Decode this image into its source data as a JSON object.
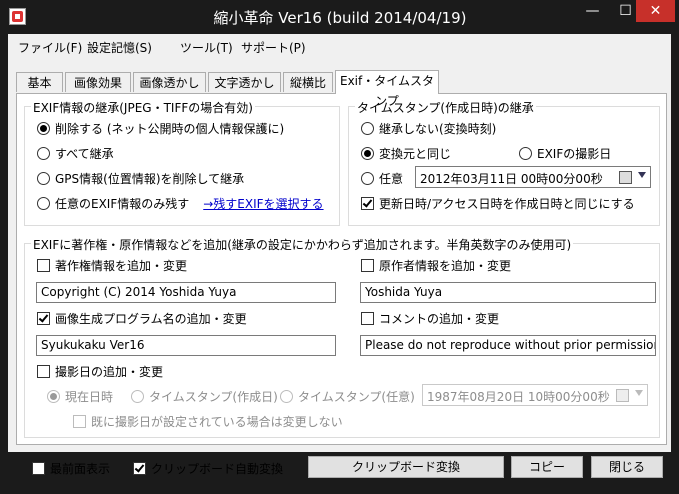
{
  "window": {
    "title": "縮小革命 Ver16  (build 2014/04/19)",
    "minimize": "—",
    "maximize": "☐",
    "close": "✕"
  },
  "menu": [
    "ファイル(F)",
    "設定記憶(S)",
    "ツール(T)",
    "サポート(P)"
  ],
  "tabs": [
    "基本",
    "画像効果",
    "画像透かし",
    "文字透かし",
    "縦横比",
    "Exif・タイムスタンプ"
  ],
  "exif_group": {
    "title": "EXIF情報の継承(JPEG・TIFFの場合有効)",
    "opt_delete": "削除する (ネット公開時の個人情報保護に)",
    "opt_inherit_all": "すべて継承",
    "opt_delete_gps": "GPS情報(位置情報)を削除して継承",
    "opt_keep_selected": "任意のEXIF情報のみ残す",
    "select_link": "→残すEXIFを選択する"
  },
  "timestamp_group": {
    "title": "タイムスタンプ(作成日時)の継承",
    "opt_no_inherit": "継承しない(変換時刻)",
    "opt_same_as_source": "変換元と同じ",
    "opt_exif_date": "EXIFの撮影日",
    "opt_custom": "任意",
    "custom_datetime": "2012年03月11日  00時00分00秒",
    "sync_update": "更新日時/アクセス日時を作成日時と同じにする"
  },
  "add_group": {
    "title": "EXIFに著作権・原作情報などを追加(継承の設定にかかわらず追加されます。半角英数字のみ使用可)",
    "copyright_label": "著作権情報を追加・変更",
    "copyright_value": "Copyright (C) 2014 Yoshida Yuya",
    "author_label": "原作者情報を追加・変更",
    "author_value": "Yoshida Yuya",
    "software_label": "画像生成プログラム名の追加・変更",
    "software_value": "Syukukaku Ver16",
    "comment_label": "コメントの追加・変更",
    "comment_value": "Please do not reproduce without prior permission.",
    "shoot_date_label": "撮影日の追加・変更",
    "opt_now": "現在日時",
    "opt_ts_created": "タイムスタンプ(作成日)",
    "opt_ts_custom": "タイムスタンプ(任意)",
    "custom_shoot_date": "1987年08月20日  10時00分00秒",
    "skip_if_set": "既に撮影日が設定されている場合は変更しない"
  },
  "footer": {
    "topmost": "最前面表示",
    "clipboard_auto": "クリップボード自動変換",
    "clipboard_convert": "クリップボード変換",
    "copy": "コピー",
    "close": "閉じる"
  }
}
